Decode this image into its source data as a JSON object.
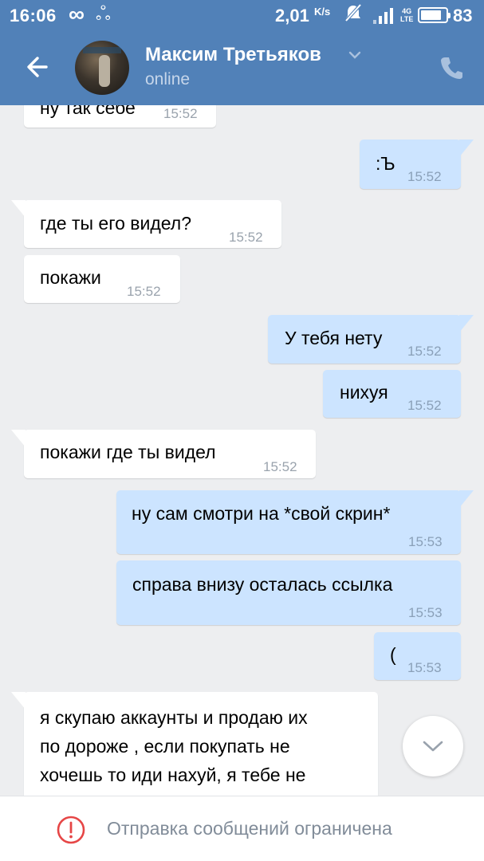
{
  "status_bar": {
    "time": "16:06",
    "infinity_symbol": "∞",
    "link_symbol": "ஃ",
    "speed_value": "2,01",
    "speed_unit": "K/s",
    "network": "4G",
    "network_sub": "LTE",
    "battery_percent": "83",
    "battery_level": 0.83
  },
  "header": {
    "contact_name": "Максим Третьяков",
    "contact_status": "online"
  },
  "messages": [
    {
      "dir": "in",
      "text": "ну так себе",
      "time": "15:52"
    },
    {
      "dir": "out",
      "text": ":Ъ",
      "time": "15:52"
    },
    {
      "dir": "in",
      "text": "где ты его видел?",
      "time": "15:52"
    },
    {
      "dir": "in",
      "text": "покажи",
      "time": "15:52"
    },
    {
      "dir": "out",
      "text": "У тебя нету",
      "time": "15:52"
    },
    {
      "dir": "out",
      "text": "нихуя",
      "time": "15:52"
    },
    {
      "dir": "in",
      "text": "покажи где ты видел",
      "time": "15:52"
    },
    {
      "dir": "out",
      "text": "ну сам смотри на *свой скрин*",
      "time": "15:53"
    },
    {
      "dir": "out",
      "text": "справа внизу осталась ссылка",
      "time": "15:53"
    },
    {
      "dir": "out",
      "text": "(",
      "time": "15:53"
    },
    {
      "dir": "in",
      "line1": "я скупаю аккаунты и продаю их",
      "line2": "по дороже , если покупать не",
      "line3": "хочешь то иди нахуй, я тебе не"
    }
  ],
  "bottom_bar": {
    "notice": "Отправка сообщений ограничена"
  },
  "colors": {
    "header_blue": "#5181b8",
    "chat_background": "#edeef0",
    "incoming_bubble": "#ffffff",
    "outgoing_bubble": "#cce4ff",
    "warning_red": "#e64646"
  },
  "icons": {
    "back": "arrow-left-icon",
    "chevron": "chevron-down-icon",
    "call": "phone-icon",
    "scroll": "chevron-down-icon",
    "warning": "exclamation-circle-icon"
  }
}
